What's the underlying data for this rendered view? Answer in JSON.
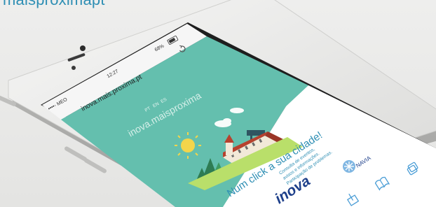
{
  "banner": {
    "text": "maisproximapt"
  },
  "status_bar": {
    "carrier": "••••◦ MEO",
    "time": "12:27",
    "battery": "68%"
  },
  "browser": {
    "url": "inova.mais.proxima.pt",
    "reload_icon": "reload-icon"
  },
  "page": {
    "languages": [
      "PT",
      "EN",
      "ES"
    ],
    "site_name": "inova.maisproxima",
    "headline": "Num click a sua cidade!",
    "subtext": [
      "Consulta de eventos,",
      "avisos e informações.",
      "Participação de problemas."
    ],
    "logo_inova": "inova",
    "logo_navia": "NAVIA"
  },
  "toolbar": {
    "icons": [
      "share-icon",
      "bookmarks-icon",
      "tabs-icon"
    ]
  },
  "colors": {
    "teal": "#64bfae",
    "accent_blue": "#2f8fb4",
    "navy": "#1d3f8a"
  }
}
